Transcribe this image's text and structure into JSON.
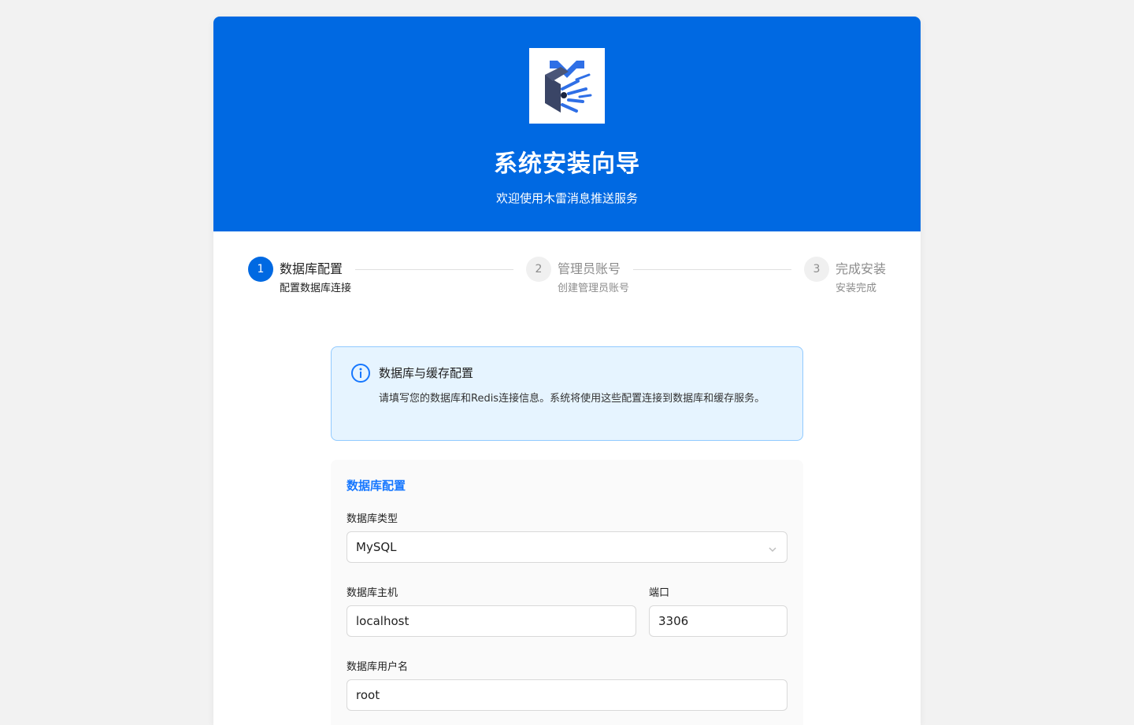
{
  "hero": {
    "title": "系统安装向导",
    "subtitle": "欢迎使用木雷消息推送服务"
  },
  "steps": [
    {
      "number": "1",
      "title": "数据库配置",
      "desc": "配置数据库连接",
      "status": "active"
    },
    {
      "number": "2",
      "title": "管理员账号",
      "desc": "创建管理员账号",
      "status": "wait"
    },
    {
      "number": "3",
      "title": "完成安装",
      "desc": "安装完成",
      "status": "wait"
    }
  ],
  "alert": {
    "icon": "info-icon",
    "title": "数据库与缓存配置",
    "desc": "请填写您的数据库和Redis连接信息。系统将使用这些配置连接到数据库和缓存服务。"
  },
  "form": {
    "section_title": "数据库配置",
    "db_type": {
      "label": "数据库类型",
      "value": "MySQL"
    },
    "db_host": {
      "label": "数据库主机",
      "value": "localhost"
    },
    "db_port": {
      "label": "端口",
      "value": "3306"
    },
    "db_user": {
      "label": "数据库用户名",
      "value": "root"
    }
  },
  "colors": {
    "primary": "#0069e2",
    "accent": "#1677ff",
    "alert_bg": "#e6f4ff",
    "alert_border": "#91caff"
  }
}
